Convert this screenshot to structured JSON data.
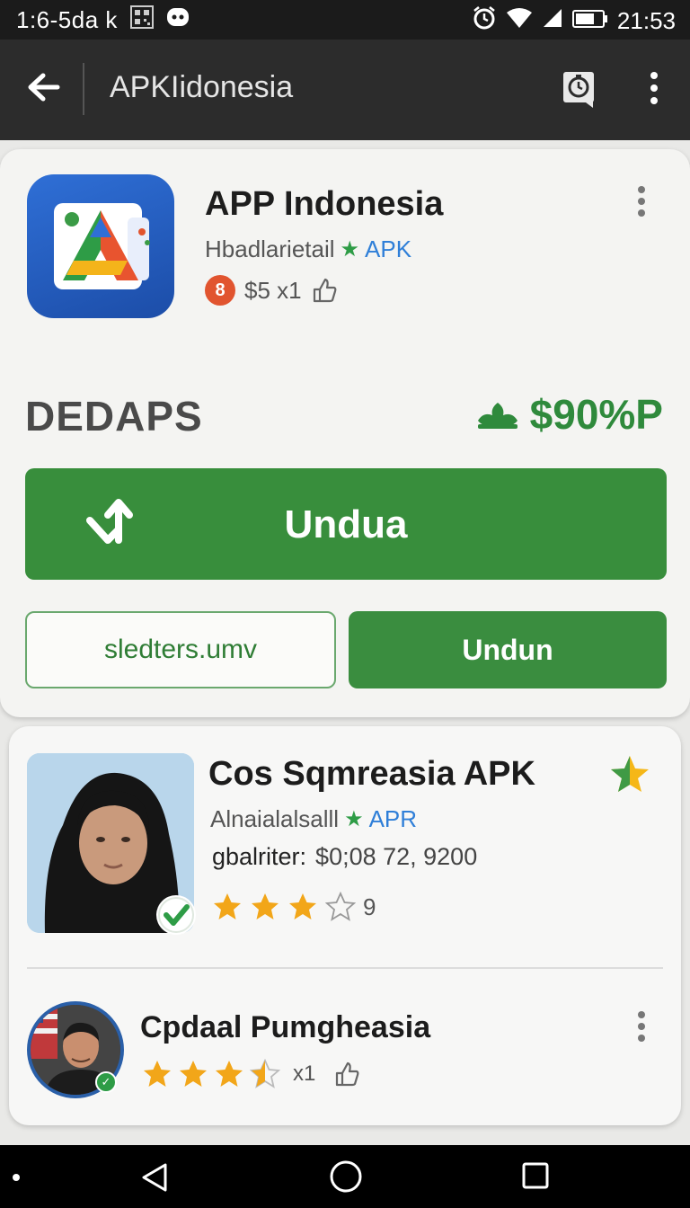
{
  "status_bar": {
    "time_left": "1:6-5da k",
    "time_right": "21:53"
  },
  "app_bar": {
    "title": "APKIidonesia"
  },
  "app_header": {
    "name": "APP Indonesia",
    "developer": "Hbadlarietail",
    "tag": "APK",
    "meta": "$5 x1"
  },
  "offer": {
    "section_title": "DEDAPS",
    "price": "$90%P"
  },
  "actions": {
    "download_label": "Unduа",
    "link_label": "sledters.umv",
    "secondary_label": "Undun"
  },
  "list_item_1": {
    "title": "Cos Sqmreasia APK",
    "developer": "Alnaialalsalll",
    "tag": "APR",
    "price_label": "gbalriter:",
    "price_values": "$0;08 72, 9200",
    "rating_count": "9",
    "rating": 3
  },
  "list_item_2": {
    "title": "Cpdaal Pumgheasia",
    "meta": "x1",
    "rating": 3.5
  },
  "colors": {
    "primary_green": "#388e3c",
    "link_blue": "#2f7fd8",
    "star_gold": "#f2a619",
    "badge_orange": "#e1542f"
  }
}
